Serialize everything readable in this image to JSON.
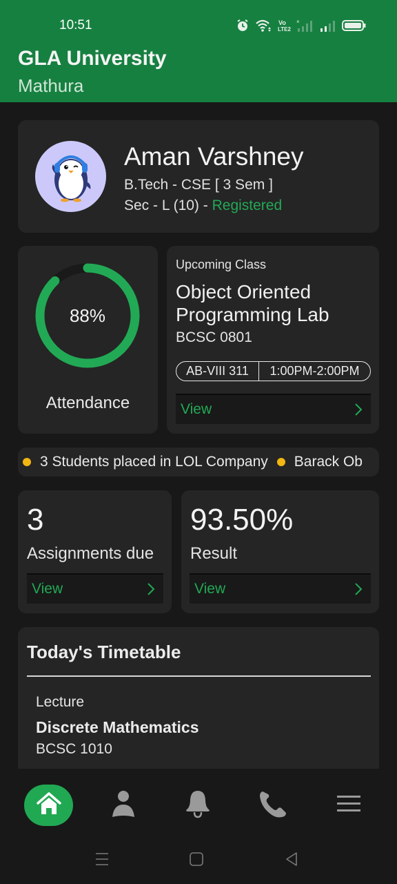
{
  "status_bar": {
    "time": "10:51",
    "icons": [
      "alarm-icon",
      "wifi-icon",
      "volte-icon",
      "signal-sim1-icon",
      "signal-sim2-icon",
      "battery-icon"
    ]
  },
  "header": {
    "title": "GLA University",
    "subtitle": "Mathura",
    "color": "#168040"
  },
  "profile": {
    "name": "Aman Varshney",
    "course": "B.Tech - CSE [ 3 Sem ]",
    "section": "Sec - L (10) - ",
    "status": "Registered",
    "status_color": "#22a955",
    "avatar": "penguin-avatar"
  },
  "attendance": {
    "percent": 88,
    "display": "88%",
    "label": "Attendance",
    "ring_color": "#22a955"
  },
  "upcoming_class": {
    "label": "Upcoming Class",
    "title": "Object Oriented Programming Lab",
    "code": "BCSC 0801",
    "room": "AB-VIII 311",
    "time": "1:00PM-2:00PM",
    "view_label": "View"
  },
  "ticker": {
    "items": [
      "3 Students placed in LOL Company",
      "Barack Ob"
    ],
    "dot_color": "#f2b711"
  },
  "assignments": {
    "value": "3",
    "label": "Assignments due",
    "view_label": "View"
  },
  "result": {
    "value": "93.50%",
    "label": "Result",
    "view_label": "View"
  },
  "timetable": {
    "title": "Today's Timetable",
    "entries": [
      {
        "type": "Lecture",
        "subject": "Discrete Mathematics",
        "code": "BCSC 1010"
      }
    ]
  },
  "bottom_nav": {
    "items": [
      {
        "icon": "home-icon",
        "active": true
      },
      {
        "icon": "profile-icon",
        "active": false
      },
      {
        "icon": "bell-icon",
        "active": false
      },
      {
        "icon": "phone-icon",
        "active": false
      },
      {
        "icon": "menu-icon",
        "active": false
      }
    ]
  },
  "system_nav": [
    "recents-icon",
    "home-square-icon",
    "back-icon"
  ]
}
